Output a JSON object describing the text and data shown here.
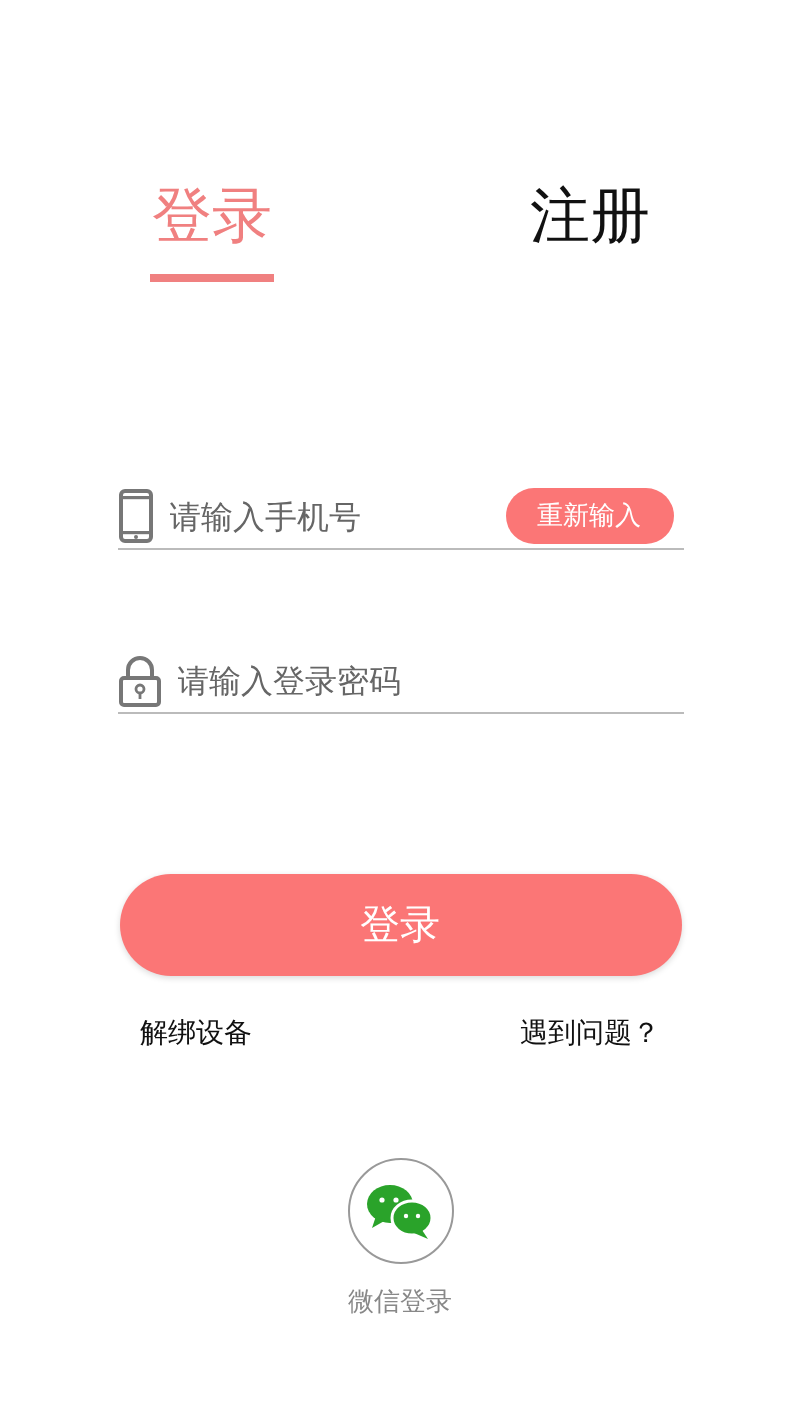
{
  "tabs": [
    {
      "label": "登录",
      "selected": true
    },
    {
      "label": "注册",
      "selected": false
    }
  ],
  "phone_field": {
    "placeholder": "请输入手机号",
    "reset_button": "重新输入"
  },
  "password_field": {
    "placeholder": "请输入登录密码"
  },
  "login_button": "登录",
  "links": [
    "解绑设备",
    "遇到问题？"
  ],
  "wechat_login": {
    "label": "微信登录"
  }
}
